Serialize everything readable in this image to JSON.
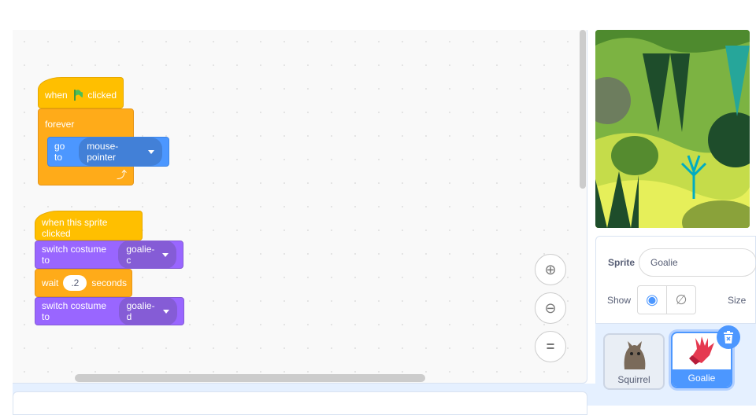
{
  "scripts": {
    "flag": {
      "when": "when",
      "clicked": "clicked",
      "forever": "forever",
      "goto": "go to",
      "goto_target": "mouse-pointer"
    },
    "sprite_clicked": {
      "hat": "when this sprite clicked",
      "switch1": "switch costume to",
      "costume1": "goalie-c",
      "wait": "wait",
      "wait_value": ".2",
      "seconds": "seconds",
      "switch2": "switch costume to",
      "costume2": "goalie-d"
    }
  },
  "zoom": {
    "in": "zoom-in-icon",
    "out": "zoom-out-icon",
    "reset": "="
  },
  "sprite_info": {
    "sprite_label": "Sprite",
    "sprite_name": "Goalie",
    "show_label": "Show",
    "size_label": "Size"
  },
  "sprites": [
    {
      "name": "Squirrel",
      "selected": false
    },
    {
      "name": "Goalie",
      "selected": true
    }
  ],
  "colors": {
    "events": "#ffbf00",
    "control": "#ffab19",
    "motion": "#4c97ff",
    "looks": "#9966ff",
    "accent": "#4c97ff"
  }
}
